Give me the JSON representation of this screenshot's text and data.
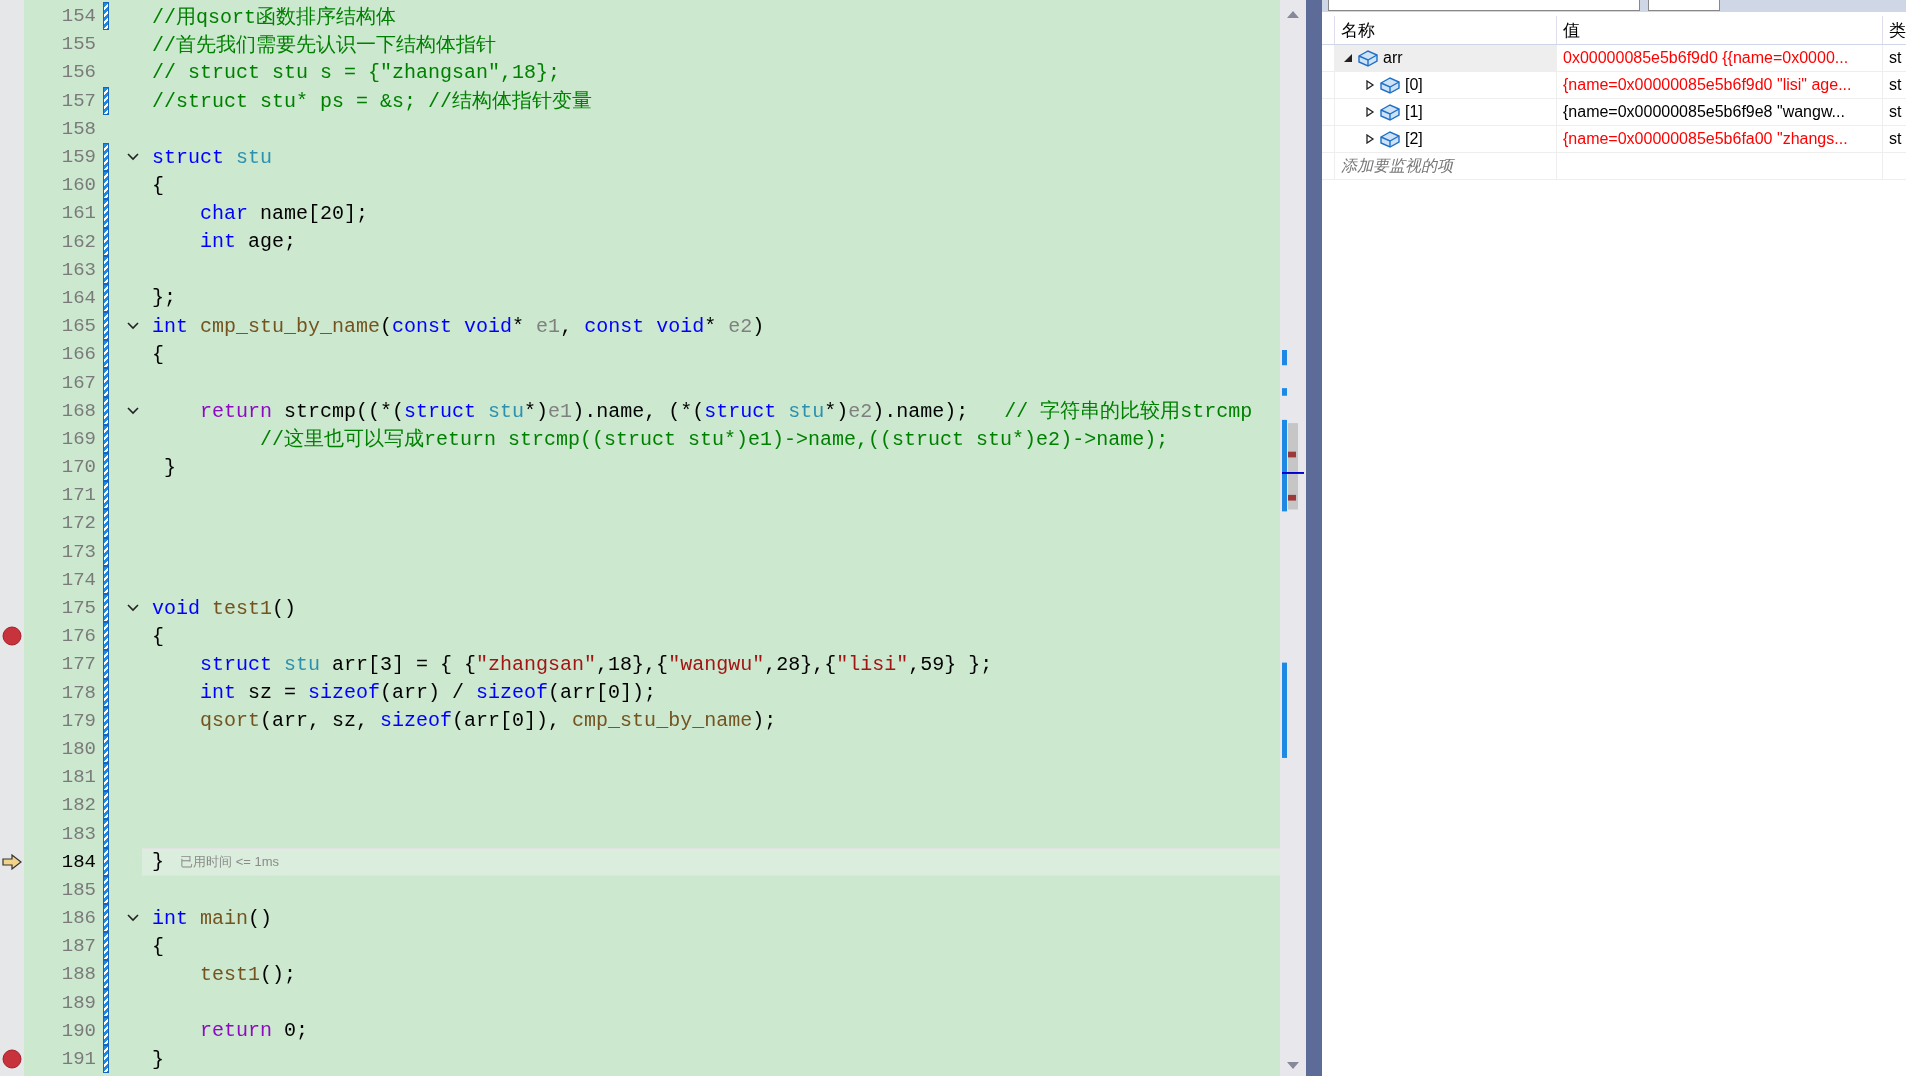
{
  "editor": {
    "lines": [
      {
        "number": "154",
        "changed": true,
        "fold": false,
        "breakpoint": false,
        "current": false,
        "tokens": [
          {
            "kind": "comment",
            "text": "//用qsort函数排序结构体"
          }
        ]
      },
      {
        "number": "155",
        "changed": false,
        "fold": false,
        "breakpoint": false,
        "current": false,
        "tokens": [
          {
            "kind": "comment",
            "text": "//首先我们需要先认识一下结构体指针"
          }
        ]
      },
      {
        "number": "156",
        "changed": false,
        "fold": false,
        "breakpoint": false,
        "current": false,
        "tokens": [
          {
            "kind": "comment",
            "text": "// struct stu s = {\"zhangsan\",18};"
          }
        ]
      },
      {
        "number": "157",
        "changed": true,
        "fold": false,
        "breakpoint": false,
        "current": false,
        "tokens": [
          {
            "kind": "comment",
            "text": "//struct stu* ps = &s; //结构体指针变量"
          }
        ]
      },
      {
        "number": "158",
        "changed": false,
        "fold": false,
        "breakpoint": false,
        "current": false
      },
      {
        "number": "159",
        "changed": true,
        "fold": true,
        "breakpoint": false,
        "current": false,
        "tokens": [
          {
            "kind": "keyword",
            "text": "struct"
          },
          {
            "kind": "type",
            "text": " stu"
          }
        ]
      },
      {
        "number": "160",
        "changed": true,
        "fold": false,
        "breakpoint": false,
        "current": false,
        "tokens": [
          {
            "kind": "plain",
            "text": "{"
          }
        ]
      },
      {
        "number": "161",
        "changed": true,
        "fold": false,
        "breakpoint": false,
        "current": false,
        "tokens": [
          {
            "kind": "keyword",
            "text": "    char"
          },
          {
            "kind": "plain",
            "text": " name[20];"
          }
        ]
      },
      {
        "number": "162",
        "changed": true,
        "fold": false,
        "breakpoint": false,
        "current": false,
        "tokens": [
          {
            "kind": "keyword",
            "text": "    int"
          },
          {
            "kind": "plain",
            "text": " age;"
          }
        ]
      },
      {
        "number": "163",
        "changed": true,
        "fold": false,
        "breakpoint": false,
        "current": false
      },
      {
        "number": "164",
        "changed": true,
        "fold": false,
        "breakpoint": false,
        "current": false,
        "tokens": [
          {
            "kind": "plain",
            "text": "};"
          }
        ]
      },
      {
        "number": "165",
        "changed": true,
        "fold": true,
        "breakpoint": false,
        "current": false,
        "tokens": [
          {
            "kind": "keyword",
            "text": "int"
          },
          {
            "kind": "function",
            "text": " cmp_stu_by_name"
          },
          {
            "kind": "plain",
            "text": "("
          },
          {
            "kind": "keyword",
            "text": "const void"
          },
          {
            "kind": "plain",
            "text": "*"
          },
          {
            "kind": "param",
            "text": " e1"
          },
          {
            "kind": "plain",
            "text": ","
          },
          {
            "kind": "keyword",
            "text": " const void"
          },
          {
            "kind": "plain",
            "text": "*"
          },
          {
            "kind": "param",
            "text": " e2"
          },
          {
            "kind": "plain",
            "text": ")"
          }
        ]
      },
      {
        "number": "166",
        "changed": true,
        "fold": false,
        "breakpoint": false,
        "current": false,
        "tokens": [
          {
            "kind": "plain",
            "text": "{"
          }
        ]
      },
      {
        "number": "167",
        "changed": true,
        "fold": false,
        "breakpoint": false,
        "current": false
      },
      {
        "number": "168",
        "changed": true,
        "fold": true,
        "breakpoint": false,
        "current": false,
        "tokens": [
          {
            "kind": "control",
            "text": "    return"
          },
          {
            "kind": "plain",
            "text": " strcmp((*("
          },
          {
            "kind": "keyword",
            "text": "struct"
          },
          {
            "kind": "type",
            "text": " stu"
          },
          {
            "kind": "plain",
            "text": "*)"
          },
          {
            "kind": "param",
            "text": "e1"
          },
          {
            "kind": "plain",
            "text": ").name, (*("
          },
          {
            "kind": "keyword",
            "text": "struct"
          },
          {
            "kind": "type",
            "text": " stu"
          },
          {
            "kind": "plain",
            "text": "*)"
          },
          {
            "kind": "param",
            "text": "e2"
          },
          {
            "kind": "plain",
            "text": ").name);"
          },
          {
            "kind": "comment",
            "text": "   // 字符串的比较用strcmp"
          }
        ]
      },
      {
        "number": "169",
        "changed": true,
        "fold": false,
        "breakpoint": false,
        "current": false,
        "tokens": [
          {
            "kind": "comment",
            "text": "         //这里也可以写成return strcmp((struct stu*)e1)->name,((struct stu*)e2)->name);"
          }
        ]
      },
      {
        "number": "170",
        "changed": true,
        "fold": false,
        "breakpoint": false,
        "current": false,
        "tokens": [
          {
            "kind": "plain",
            "text": " }"
          }
        ]
      },
      {
        "number": "171",
        "changed": true,
        "fold": false,
        "breakpoint": false,
        "current": false
      },
      {
        "number": "172",
        "changed": true,
        "fold": false,
        "breakpoint": false,
        "current": false
      },
      {
        "number": "173",
        "changed": true,
        "fold": false,
        "breakpoint": false,
        "current": false
      },
      {
        "number": "174",
        "changed": true,
        "fold": false,
        "breakpoint": false,
        "current": false
      },
      {
        "number": "175",
        "changed": true,
        "fold": true,
        "breakpoint": false,
        "current": false,
        "tokens": [
          {
            "kind": "keyword",
            "text": "void"
          },
          {
            "kind": "function",
            "text": " test1"
          },
          {
            "kind": "plain",
            "text": "()"
          }
        ]
      },
      {
        "number": "176",
        "changed": true,
        "fold": false,
        "breakpoint": true,
        "current": false,
        "tokens": [
          {
            "kind": "plain",
            "text": "{"
          }
        ]
      },
      {
        "number": "177",
        "changed": true,
        "fold": false,
        "breakpoint": false,
        "current": false,
        "tokens": [
          {
            "kind": "keyword",
            "text": "    struct"
          },
          {
            "kind": "type",
            "text": " stu"
          },
          {
            "kind": "plain",
            "text": " arr[3] = { {"
          },
          {
            "kind": "string",
            "text": "\"zhangsan\""
          },
          {
            "kind": "plain",
            "text": ",18},{"
          },
          {
            "kind": "string",
            "text": "\"wangwu\""
          },
          {
            "kind": "plain",
            "text": ",28},{"
          },
          {
            "kind": "string",
            "text": "\"lisi\""
          },
          {
            "kind": "plain",
            "text": ",59} };"
          }
        ]
      },
      {
        "number": "178",
        "changed": true,
        "fold": false,
        "breakpoint": false,
        "current": false,
        "tokens": [
          {
            "kind": "keyword",
            "text": "    int"
          },
          {
            "kind": "plain",
            "text": " sz ="
          },
          {
            "kind": "keyword",
            "text": " sizeof"
          },
          {
            "kind": "plain",
            "text": "(arr) /"
          },
          {
            "kind": "keyword",
            "text": " sizeof"
          },
          {
            "kind": "plain",
            "text": "(arr[0]);"
          }
        ]
      },
      {
        "number": "179",
        "changed": true,
        "fold": false,
        "breakpoint": false,
        "current": false,
        "tokens": [
          {
            "kind": "function",
            "text": "    qsort"
          },
          {
            "kind": "plain",
            "text": "(arr, sz,"
          },
          {
            "kind": "keyword",
            "text": " sizeof"
          },
          {
            "kind": "plain",
            "text": "(arr[0]),"
          },
          {
            "kind": "function",
            "text": " cmp_stu_by_name"
          },
          {
            "kind": "plain",
            "text": ");"
          }
        ]
      },
      {
        "number": "180",
        "changed": true,
        "fold": false,
        "breakpoint": false,
        "current": false
      },
      {
        "number": "181",
        "changed": true,
        "fold": false,
        "breakpoint": false,
        "current": false
      },
      {
        "number": "182",
        "changed": true,
        "fold": false,
        "breakpoint": false,
        "current": false
      },
      {
        "number": "183",
        "changed": true,
        "fold": false,
        "breakpoint": false,
        "current": false
      },
      {
        "number": "184",
        "changed": true,
        "fold": false,
        "breakpoint": false,
        "current": true,
        "tokens": [
          {
            "kind": "plain",
            "text": "}"
          }
        ],
        "hint": "已用时间 <= 1ms"
      },
      {
        "number": "185",
        "changed": true,
        "fold": false,
        "breakpoint": false,
        "current": false
      },
      {
        "number": "186",
        "changed": true,
        "fold": true,
        "breakpoint": false,
        "current": false,
        "tokens": [
          {
            "kind": "keyword",
            "text": "int"
          },
          {
            "kind": "function",
            "text": " main"
          },
          {
            "kind": "plain",
            "text": "()"
          }
        ]
      },
      {
        "number": "187",
        "changed": true,
        "fold": false,
        "breakpoint": false,
        "current": false,
        "tokens": [
          {
            "kind": "plain",
            "text": "{"
          }
        ]
      },
      {
        "number": "188",
        "changed": true,
        "fold": false,
        "breakpoint": false,
        "current": false,
        "tokens": [
          {
            "kind": "function",
            "text": "    test1"
          },
          {
            "kind": "plain",
            "text": "();"
          }
        ]
      },
      {
        "number": "189",
        "changed": true,
        "fold": false,
        "breakpoint": false,
        "current": false
      },
      {
        "number": "190",
        "changed": true,
        "fold": false,
        "breakpoint": false,
        "current": false,
        "tokens": [
          {
            "kind": "control",
            "text": "    return"
          },
          {
            "kind": "plain",
            "text": " 0;"
          }
        ]
      },
      {
        "number": "191",
        "changed": true,
        "fold": false,
        "breakpoint": true,
        "current": false,
        "tokens": [
          {
            "kind": "plain",
            "text": "}"
          }
        ]
      }
    ]
  },
  "watch": {
    "columns": [
      "名称",
      "值",
      "类"
    ],
    "rows": [
      {
        "name": "arr",
        "value": "0x00000085e5b6f9d0 {{name=0x0000...",
        "type": "st",
        "changed": true,
        "expanded": true,
        "selected": true,
        "children": [
          {
            "name": "[0]",
            "value": "{name=0x00000085e5b6f9d0 \"lisi\" age...",
            "type": "st",
            "changed": true,
            "expanded": false,
            "selected": false
          },
          {
            "name": "[1]",
            "value": "{name=0x00000085e5b6f9e8 \"wangw...",
            "type": "st",
            "changed": false,
            "expanded": false,
            "selected": false
          },
          {
            "name": "[2]",
            "value": "{name=0x00000085e5b6fa00 \"zhangs...",
            "type": "st",
            "changed": true,
            "expanded": false,
            "selected": false
          }
        ]
      }
    ],
    "add_placeholder": "添加要监视的项"
  }
}
